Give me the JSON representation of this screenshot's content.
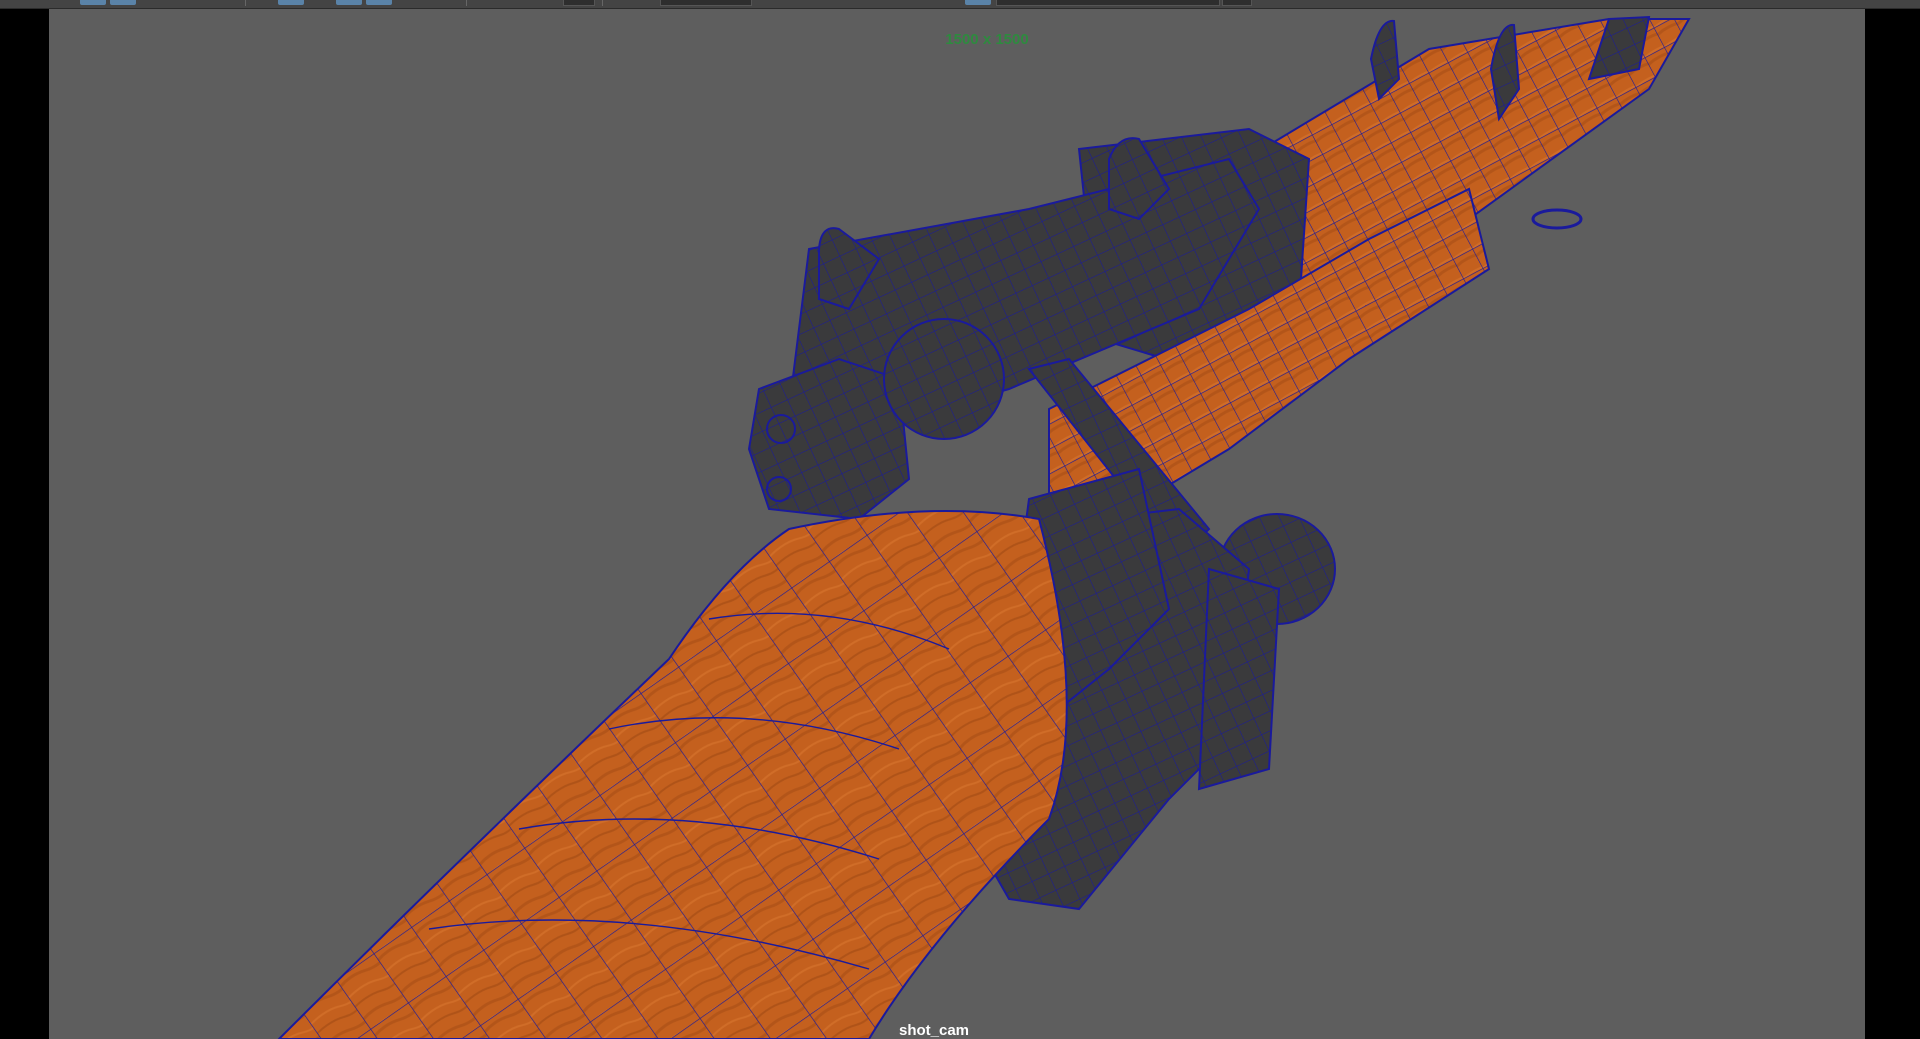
{
  "viewport": {
    "resolution_gate_label": "1500 x 1500",
    "camera_name": "shot_cam",
    "background_color": "#5e5e5e",
    "wireframe_color": "#1a1a9c",
    "wood_color": "#c4601e",
    "metal_color": "#3a3a3c",
    "resolution_label_color": "#2e8a3f"
  },
  "toolbar": {
    "icons": [
      "view-icon",
      "camera-icon",
      "grid-icon",
      "shading-icon",
      "lighting-icon",
      "isolate-icon",
      "xray-icon",
      "resolution-gate-icon"
    ]
  }
}
